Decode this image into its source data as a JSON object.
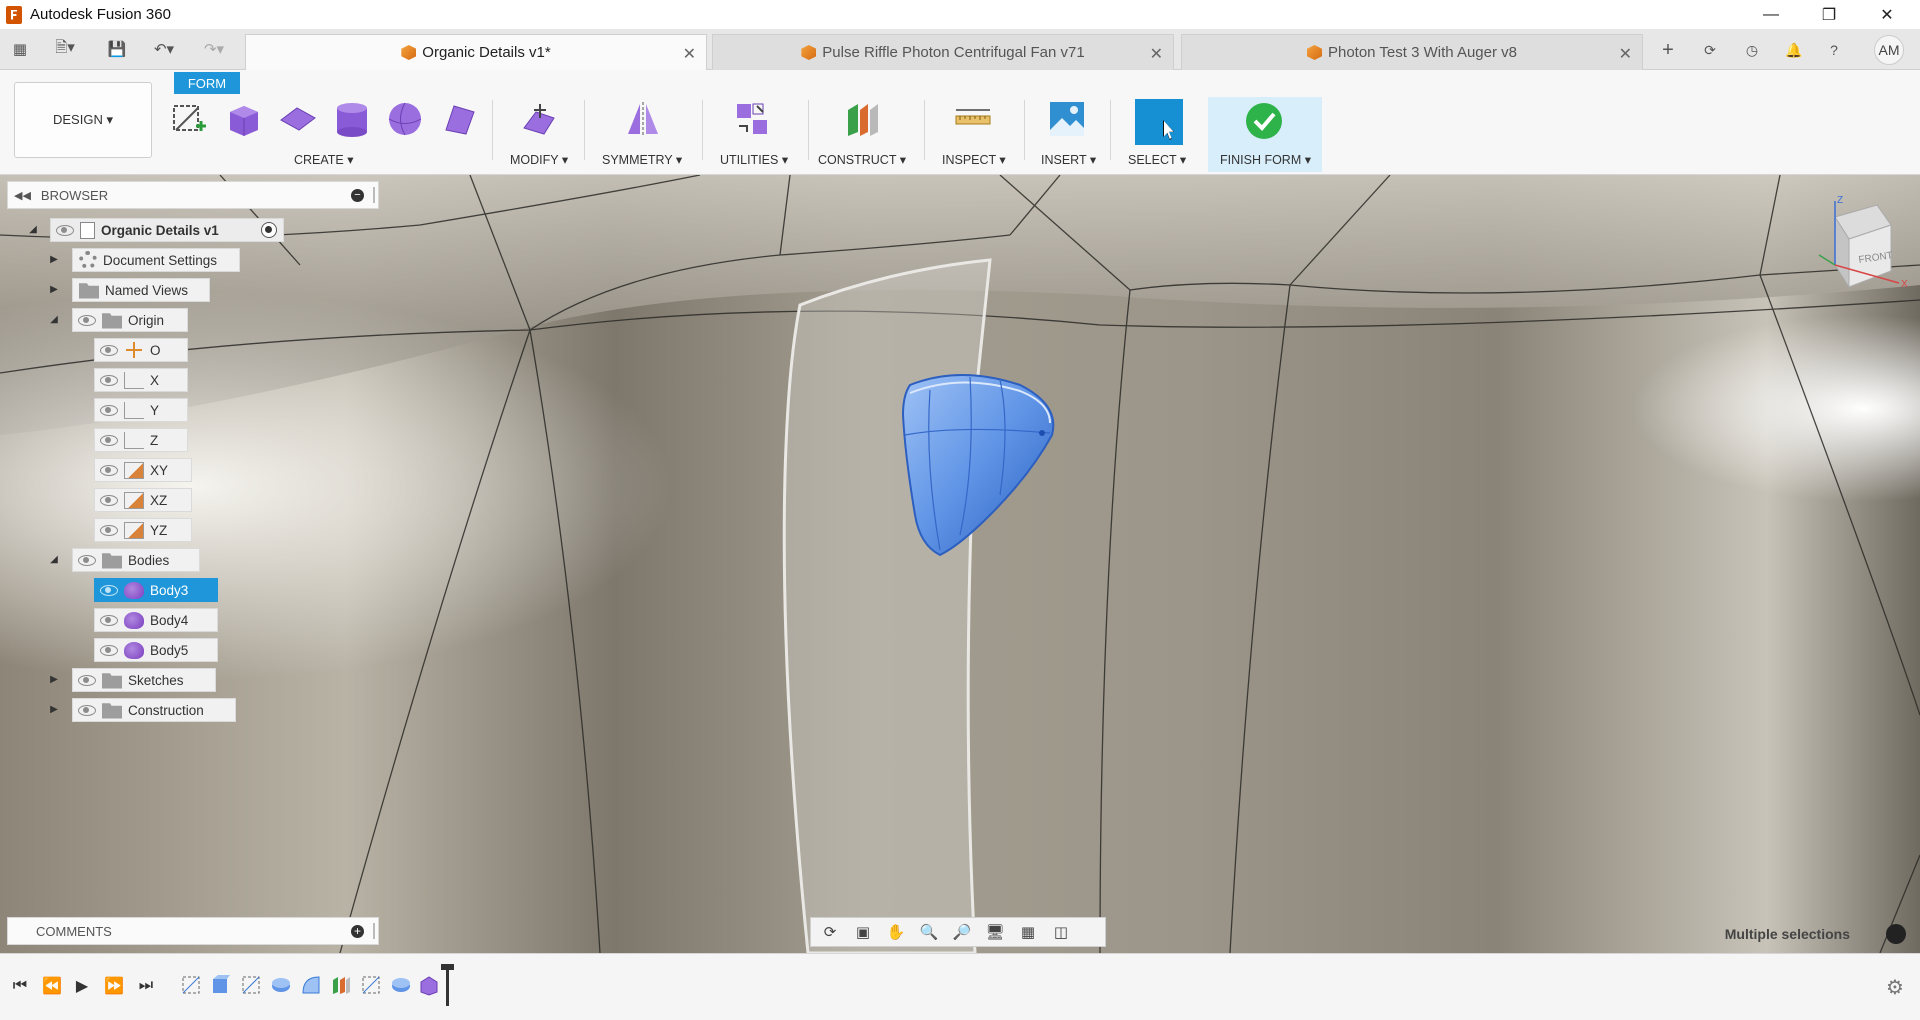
{
  "app": {
    "title": "Autodesk Fusion 360"
  },
  "tabs": [
    {
      "label": "Organic Details v1*",
      "active": true
    },
    {
      "label": "Pulse Riffle Photon Centrifugal Fan v71",
      "active": false
    },
    {
      "label": "Photon Test 3 With Auger v8",
      "active": false
    }
  ],
  "user": {
    "initials": "AM"
  },
  "toolbar": {
    "workspace": "DESIGN ▾",
    "active_tab": "FORM",
    "groups": [
      {
        "label": "CREATE ▾"
      },
      {
        "label": "MODIFY ▾"
      },
      {
        "label": "SYMMETRY ▾"
      },
      {
        "label": "UTILITIES ▾"
      },
      {
        "label": "CONSTRUCT ▾"
      },
      {
        "label": "INSPECT ▾"
      },
      {
        "label": "INSERT ▾"
      },
      {
        "label": "SELECT ▾"
      },
      {
        "label": "FINISH FORM ▾"
      }
    ]
  },
  "browser": {
    "title": "BROWSER",
    "root": "Organic Details v1",
    "items": [
      {
        "label": "Document Settings"
      },
      {
        "label": "Named Views"
      },
      {
        "label": "Origin"
      },
      {
        "label": "O"
      },
      {
        "label": "X"
      },
      {
        "label": "Y"
      },
      {
        "label": "Z"
      },
      {
        "label": "XY"
      },
      {
        "label": "XZ"
      },
      {
        "label": "YZ"
      },
      {
        "label": "Bodies"
      },
      {
        "label": "Body3"
      },
      {
        "label": "Body4"
      },
      {
        "label": "Body5"
      },
      {
        "label": "Sketches"
      },
      {
        "label": "Construction"
      }
    ]
  },
  "comments": {
    "title": "COMMENTS"
  },
  "viewcube": {
    "face": "FRONT"
  },
  "status": {
    "text": "Multiple selections"
  },
  "colors": {
    "accent": "#1f96d9",
    "selection": "#3a7bd5",
    "finish_bg": "#d8eefb"
  }
}
